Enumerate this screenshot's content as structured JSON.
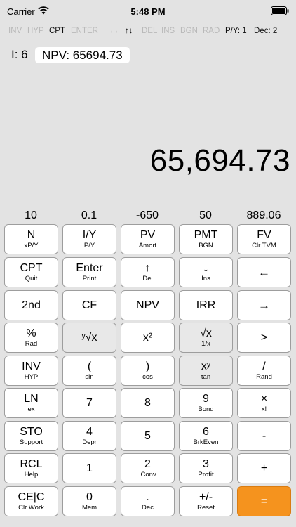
{
  "status": {
    "carrier": "Carrier",
    "time": "5:48 PM"
  },
  "modes": {
    "inv": "INV",
    "hyp": "HYP",
    "cpt": "CPT",
    "enter": "ENTER",
    "arrows_lr": "→←",
    "arrows_ud": "↑↓",
    "del": "DEL",
    "ins": "INS",
    "bgn": "BGN",
    "rad": "RAD",
    "py": "P/Y: 1",
    "dec": "Dec: 2"
  },
  "register": {
    "i_label": "I: 6",
    "npv_label": "NPV: 65694.73"
  },
  "display": {
    "value": "65,694.73"
  },
  "tvm_values": [
    "10",
    "0.1",
    "-650",
    "50",
    "889.06"
  ],
  "keys": {
    "r1": [
      {
        "main": "N",
        "sub": "xP/Y"
      },
      {
        "main": "I/Y",
        "sub": "P/Y"
      },
      {
        "main": "PV",
        "sub": "Amort"
      },
      {
        "main": "PMT",
        "sub": "BGN"
      },
      {
        "main": "FV",
        "sub": "Clr TVM"
      }
    ],
    "r2": [
      {
        "main": "CPT",
        "sub": "Quit"
      },
      {
        "main": "Enter",
        "sub": "Print"
      },
      {
        "main": "↑",
        "sub": "Del"
      },
      {
        "main": "↓",
        "sub": "Ins"
      },
      {
        "main": "←",
        "sub": ""
      }
    ],
    "r3": [
      {
        "main": "2nd",
        "sub": ""
      },
      {
        "main": "CF",
        "sub": ""
      },
      {
        "main": "NPV",
        "sub": ""
      },
      {
        "main": "IRR",
        "sub": ""
      },
      {
        "main": "→",
        "sub": ""
      }
    ],
    "r4": [
      {
        "main": "%",
        "sub": "Rad"
      },
      {
        "main": "ʸ√x",
        "sub": ""
      },
      {
        "main": "x²",
        "sub": ""
      },
      {
        "main": "√x",
        "sub": "1/x"
      },
      {
        "main": ">",
        "sub": ""
      }
    ],
    "r5": [
      {
        "main": "INV",
        "sub": "HYP"
      },
      {
        "main": "(",
        "sub": "sin"
      },
      {
        "main": ")",
        "sub": "cos"
      },
      {
        "main": "xʸ",
        "sub": "tan"
      },
      {
        "main": "/",
        "sub": "Rand"
      }
    ],
    "r6": [
      {
        "main": "LN",
        "sub": "ex"
      },
      {
        "main": "7",
        "sub": ""
      },
      {
        "main": "8",
        "sub": ""
      },
      {
        "main": "9",
        "sub": "Bond"
      },
      {
        "main": "×",
        "sub": "x!"
      }
    ],
    "r7": [
      {
        "main": "STO",
        "sub": "Support"
      },
      {
        "main": "4",
        "sub": "Depr"
      },
      {
        "main": "5",
        "sub": ""
      },
      {
        "main": "6",
        "sub": "BrkEven"
      },
      {
        "main": "-",
        "sub": ""
      }
    ],
    "r8": [
      {
        "main": "RCL",
        "sub": "Help"
      },
      {
        "main": "1",
        "sub": ""
      },
      {
        "main": "2",
        "sub": "iConv"
      },
      {
        "main": "3",
        "sub": "Profit"
      },
      {
        "main": "+",
        "sub": ""
      }
    ],
    "r9": [
      {
        "main": "CE|C",
        "sub": "Clr Work"
      },
      {
        "main": "0",
        "sub": "Mem"
      },
      {
        "main": ".",
        "sub": "Dec"
      },
      {
        "main": "+/-",
        "sub": "Reset"
      },
      {
        "main": "=",
        "sub": ""
      }
    ]
  },
  "colors": {
    "accent": "#f5931e",
    "background": "#e3e3e3",
    "key": "#ffffff",
    "key_gray": "#e8e8e8"
  }
}
